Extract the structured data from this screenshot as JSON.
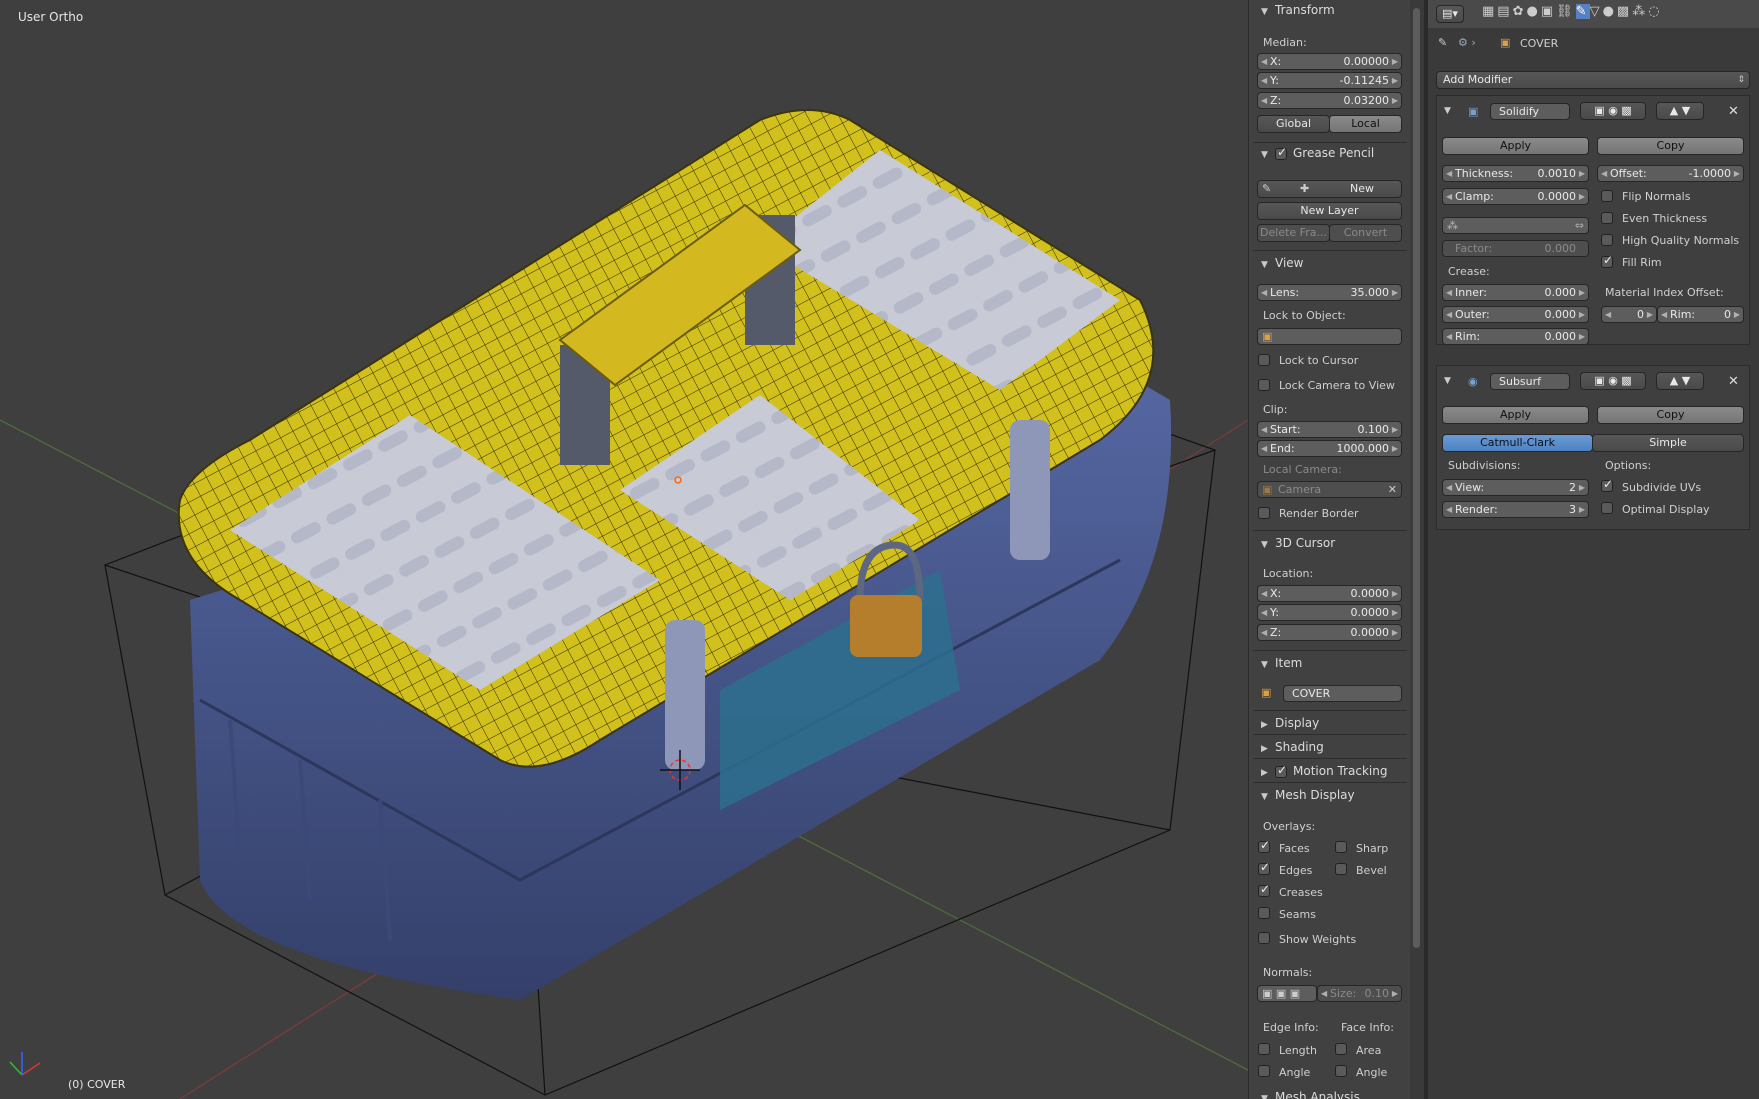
{
  "viewport": {
    "title": "User Ortho",
    "status": "(0) COVER",
    "colors": {
      "background": "#3f3f3f",
      "lid": "#d6c21a",
      "body": "#4a5f9a",
      "handle": "#cfb31e",
      "lock": "#c0892e",
      "panel": "#c9ccd8"
    }
  },
  "npanel": {
    "transform": {
      "header": "Transform",
      "median_label": "Median:",
      "x": {
        "label": "X:",
        "value": "0.00000"
      },
      "y": {
        "label": "Y:",
        "value": "-0.11245"
      },
      "z": {
        "label": "Z:",
        "value": "0.03200"
      },
      "global": "Global",
      "local": "Local"
    },
    "grease": {
      "header": "Grease Pencil",
      "new": "New",
      "new_layer": "New Layer",
      "delete_frame": "Delete Fra...",
      "convert": "Convert"
    },
    "view": {
      "header": "View",
      "lens": {
        "label": "Lens:",
        "value": "35.000"
      },
      "lock_to_object": "Lock to Object:",
      "lock_to_cursor": "Lock to Cursor",
      "lock_camera": "Lock Camera to View",
      "clip": "Clip:",
      "start": {
        "label": "Start:",
        "value": "0.100"
      },
      "end": {
        "label": "End:",
        "value": "1000.000"
      },
      "local_camera": "Local Camera:",
      "camera": "Camera",
      "render_border": "Render Border"
    },
    "cursor": {
      "header": "3D Cursor",
      "location": "Location:",
      "x": {
        "label": "X:",
        "value": "0.0000"
      },
      "y": {
        "label": "Y:",
        "value": "0.0000"
      },
      "z": {
        "label": "Z:",
        "value": "0.0000"
      }
    },
    "item": {
      "header": "Item",
      "name": "COVER"
    },
    "display": "Display",
    "shading": "Shading",
    "motion": "Motion Tracking",
    "mesh": {
      "header": "Mesh Display",
      "overlays": "Overlays:",
      "faces": "Faces",
      "sharp": "Sharp",
      "edges": "Edges",
      "bevel": "Bevel",
      "creases": "Creases",
      "seams": "Seams",
      "show_weights": "Show Weights",
      "normals": "Normals:",
      "size": {
        "label": "Size:",
        "value": "0.10"
      },
      "edge_info": "Edge Info:",
      "face_info": "Face Info:",
      "length": "Length",
      "area": "Area",
      "angle1": "Angle",
      "angle2": "Angle",
      "mesh_analysis": "Mesh Analysis"
    }
  },
  "props": {
    "breadcrumb": "COVER",
    "add_modifier": "Add Modifier",
    "solidify": {
      "name": "Solidify",
      "apply": "Apply",
      "copy": "Copy",
      "thickness": {
        "label": "Thickness:",
        "value": "0.0010"
      },
      "offset": {
        "label": "Offset:",
        "value": "-1.0000"
      },
      "clamp": {
        "label": "Clamp:",
        "value": "0.0000"
      },
      "flip_normals": "Flip Normals",
      "even_thickness": "Even Thickness",
      "high_quality": "High Quality Normals",
      "fill_rim": "Fill Rim",
      "factor": {
        "label": "Factor:",
        "value": "0.000"
      },
      "crease": "Crease:",
      "inner": {
        "label": "Inner:",
        "value": "0.000"
      },
      "outer": {
        "label": "Outer:",
        "value": "0.000"
      },
      "rim": {
        "label": "Rim:",
        "value": "0.000"
      },
      "mat_offset": "Material Index Offset:",
      "mat_value": "0",
      "mat_rim": {
        "label": "Rim:",
        "value": "0"
      }
    },
    "subsurf": {
      "name": "Subsurf",
      "apply": "Apply",
      "copy": "Copy",
      "catmull": "Catmull-Clark",
      "simple": "Simple",
      "subdivisions": "Subdivisions:",
      "options": "Options:",
      "view": {
        "label": "View:",
        "value": "2"
      },
      "render": {
        "label": "Render:",
        "value": "3"
      },
      "subdivide_uvs": "Subdivide UVs",
      "optimal_display": "Optimal Display"
    }
  }
}
